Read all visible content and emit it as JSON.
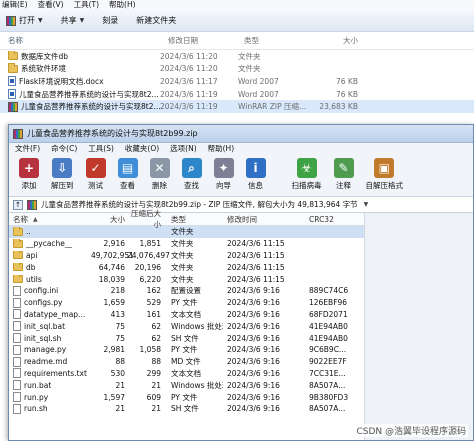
{
  "explorer": {
    "menu": [
      "编辑(E)",
      "查看(V)",
      "工具(T)",
      "帮助(H)"
    ],
    "toolbar": {
      "open": "打开",
      "share": "共享",
      "burn": "刻录",
      "new_folder": "新建文件夹"
    },
    "columns": {
      "name": "名称",
      "date": "修改日期",
      "type": "类型",
      "size": "大小"
    },
    "files": [
      {
        "icon": "folder-icon",
        "name": "数据库文件db",
        "date": "2024/3/6 11:20",
        "type": "文件夹",
        "size": ""
      },
      {
        "icon": "folder-icon",
        "name": "系统软件环境",
        "date": "2024/3/6 11:20",
        "type": "文件夹",
        "size": ""
      },
      {
        "icon": "word-doc-icon",
        "name": "Flask环境说明文档.docx",
        "date": "2024/3/6 11:17",
        "type": "Word 2007",
        "size": "76 KB"
      },
      {
        "icon": "word-doc-icon",
        "name": "儿童食品营养推荐系统的设计与实现8t2...",
        "date": "2024/3/6 11:19",
        "type": "Word 2007",
        "size": "76 KB"
      },
      {
        "icon": "rar-archive-icon",
        "name": "儿童食品营养推荐系统的设计与实现8t2...",
        "date": "2024/3/6 11:19",
        "type": "WinRAR ZIP 压缩...",
        "size": "23,683 KB"
      }
    ]
  },
  "winrar": {
    "title": "儿童食品营养推荐系统的设计与实现8t2b99.zip",
    "menu": [
      "文件(F)",
      "命令(C)",
      "工具(S)",
      "收藏夹(O)",
      "选项(N)",
      "帮助(H)"
    ],
    "toolbar": [
      {
        "label": "添加",
        "icon": "add-books-icon",
        "color": "#b7343f",
        "glyph": "+"
      },
      {
        "label": "解压到",
        "icon": "extract-to-icon",
        "color": "#4a7cc4",
        "glyph": "⇩"
      },
      {
        "label": "测试",
        "icon": "test-icon",
        "color": "#c0392b",
        "glyph": "✓"
      },
      {
        "label": "查看",
        "icon": "view-icon",
        "color": "#3f8ed8",
        "glyph": "▤"
      },
      {
        "label": "删除",
        "icon": "delete-icon",
        "color": "#8b97a6",
        "glyph": "✕"
      },
      {
        "label": "查找",
        "icon": "find-icon",
        "color": "#2d86c9",
        "glyph": "⌕"
      },
      {
        "label": "向导",
        "icon": "wizard-icon",
        "color": "#7e7e95",
        "glyph": "✦"
      },
      {
        "label": "信息",
        "icon": "info-icon",
        "color": "#2f6fc6",
        "glyph": "i"
      },
      {
        "label": "扫描病毒",
        "icon": "scan-virus-icon",
        "color": "#3fa245",
        "glyph": "☣"
      },
      {
        "label": "注释",
        "icon": "comment-icon",
        "color": "#4f9b4f",
        "glyph": "✎"
      },
      {
        "label": "自解压格式",
        "icon": "sfx-icon",
        "color": "#c07a2a",
        "glyph": "▣"
      }
    ],
    "path_text": "儿童食品营养推荐系统的设计与实现8t2b99.zip - ZIP 压缩文件, 解包大小为 49,813,964 字节",
    "columns": {
      "name": "名称",
      "size": "大小",
      "packed": "压缩后大小",
      "type": "类型",
      "modified": "修改时间",
      "crc": "CRC32"
    },
    "rows": [
      {
        "icon": "folder-up-icon",
        "name": "..",
        "size": "",
        "packed": "",
        "type": "文件夹",
        "modified": "",
        "crc": ""
      },
      {
        "icon": "folder-icon",
        "name": "__pycache__",
        "size": "2,916",
        "packed": "1,851",
        "type": "文件夹",
        "modified": "2024/3/6 11:15",
        "crc": ""
      },
      {
        "icon": "folder-icon",
        "name": "api",
        "size": "49,702,951",
        "packed": "24,076,497",
        "type": "文件夹",
        "modified": "2024/3/6 11:15",
        "crc": ""
      },
      {
        "icon": "folder-icon",
        "name": "db",
        "size": "64,746",
        "packed": "20,196",
        "type": "文件夹",
        "modified": "2024/3/6 11:15",
        "crc": ""
      },
      {
        "icon": "folder-icon",
        "name": "utils",
        "size": "18,039",
        "packed": "6,220",
        "type": "文件夹",
        "modified": "2024/3/6 11:15",
        "crc": ""
      },
      {
        "icon": "file-icon",
        "name": "config.ini",
        "size": "218",
        "packed": "162",
        "type": "配置设置",
        "modified": "2024/3/6 9:16",
        "crc": "889C74C6"
      },
      {
        "icon": "file-icon",
        "name": "configs.py",
        "size": "1,659",
        "packed": "529",
        "type": "PY 文件",
        "modified": "2024/3/6 9:16",
        "crc": "126EBF96"
      },
      {
        "icon": "file-icon",
        "name": "datatype_map...",
        "size": "413",
        "packed": "161",
        "type": "文本文档",
        "modified": "2024/3/6 9:16",
        "crc": "68FD2071"
      },
      {
        "icon": "file-icon",
        "name": "init_sql.bat",
        "size": "75",
        "packed": "62",
        "type": "Windows 批处理...",
        "modified": "2024/3/6 9:16",
        "crc": "41E94AB0"
      },
      {
        "icon": "file-icon",
        "name": "init_sql.sh",
        "size": "75",
        "packed": "62",
        "type": "SH 文件",
        "modified": "2024/3/6 9:16",
        "crc": "41E94AB0"
      },
      {
        "icon": "file-icon",
        "name": "manage.py",
        "size": "2,981",
        "packed": "1,058",
        "type": "PY 文件",
        "modified": "2024/3/6 9:16",
        "crc": "9C6B9C..."
      },
      {
        "icon": "file-icon",
        "name": "readme.md",
        "size": "88",
        "packed": "88",
        "type": "MD 文件",
        "modified": "2024/3/6 9:16",
        "crc": "9022EE7F"
      },
      {
        "icon": "file-icon",
        "name": "requirements.txt",
        "size": "530",
        "packed": "299",
        "type": "文本文档",
        "modified": "2024/3/6 9:16",
        "crc": "7CC31E..."
      },
      {
        "icon": "file-icon",
        "name": "run.bat",
        "size": "21",
        "packed": "21",
        "type": "Windows 批处理...",
        "modified": "2024/3/6 9:16",
        "crc": "8A507A..."
      },
      {
        "icon": "file-icon",
        "name": "run.py",
        "size": "1,597",
        "packed": "609",
        "type": "PY 文件",
        "modified": "2024/3/6 9:16",
        "crc": "9B380FD3"
      },
      {
        "icon": "file-icon",
        "name": "run.sh",
        "size": "21",
        "packed": "21",
        "type": "SH 文件",
        "modified": "2024/3/6 9:16",
        "crc": "8A507A..."
      }
    ]
  },
  "watermark": "CSDN @浩翼毕设程序源码"
}
